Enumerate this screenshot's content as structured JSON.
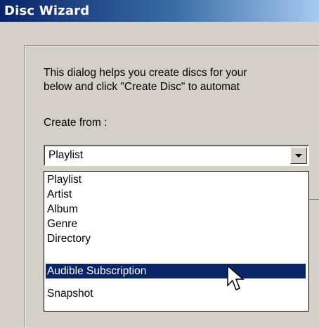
{
  "window": {
    "title": "Disc Wizard"
  },
  "intro": {
    "line1": "This dialog helps you create discs for your",
    "line2": "below and click \"Create Disc\" to automat"
  },
  "create_from": {
    "label": "Create from :",
    "selected": "Playlist",
    "options": [
      "Playlist",
      "Artist",
      "Album",
      "Genre",
      "Directory",
      "Audible Subscription",
      "Snapshot"
    ],
    "highlighted_index": 5
  },
  "colors": {
    "selection": "#0a246a",
    "title_start": "#0a246a",
    "title_end": "#a6caf0"
  }
}
